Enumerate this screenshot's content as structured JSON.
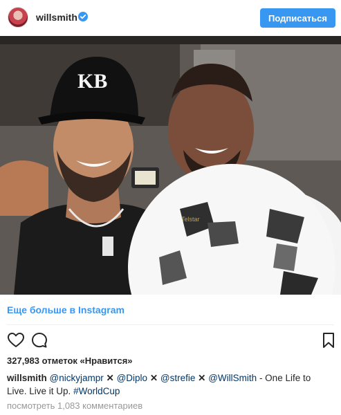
{
  "header": {
    "username": "willsmith",
    "follow_label": "Подписаться"
  },
  "photo": {
    "cap_logo": "KB",
    "ball_brand": "Telstar"
  },
  "more_link": "Еще больше в Instagram",
  "likes_text": "327,983 отметок «Нравится»",
  "caption": {
    "author": "willsmith",
    "mentions": [
      "@nickyjampr",
      "@Diplo",
      "@strefie",
      "@WillSmith"
    ],
    "separator": "✕",
    "text": "- One Life to Live. Live it Up.",
    "hashtag": "#WorldCup"
  },
  "comments_text": "посмотреть 1,083 комментариев",
  "colors": {
    "accent": "#3897f0",
    "text": "#262626",
    "muted": "#999999"
  },
  "icons": [
    "verified-icon",
    "heart-icon",
    "comment-icon",
    "bookmark-icon"
  ]
}
